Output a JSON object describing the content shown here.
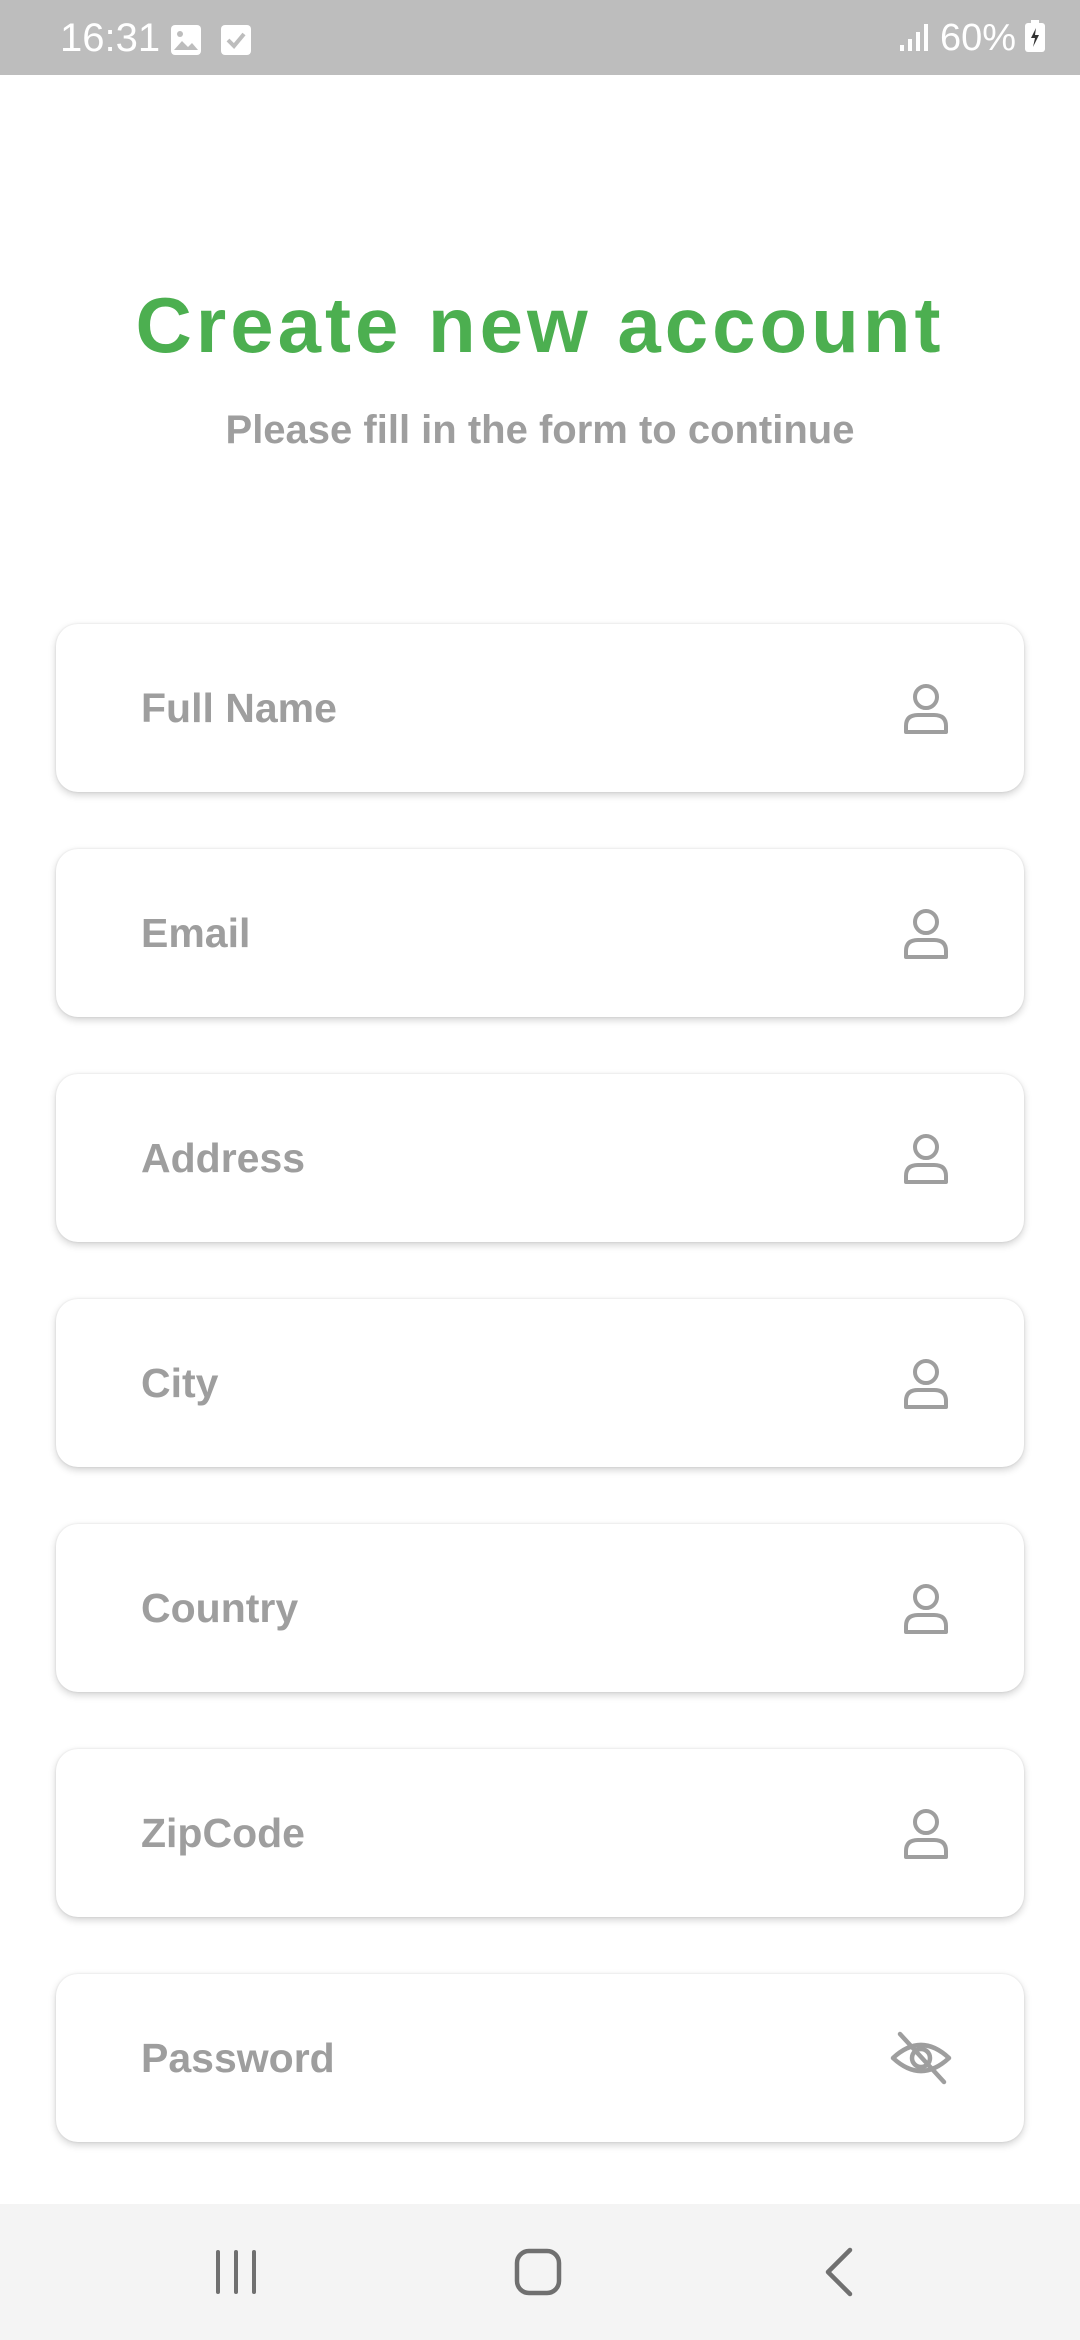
{
  "status_bar": {
    "time": "16:31",
    "battery": "60%",
    "icons": [
      "image-icon",
      "check-box-icon",
      "signal-icon",
      "battery-icon"
    ]
  },
  "header": {
    "title": "Create new account",
    "subtitle": "Please fill in the form to continue"
  },
  "form": {
    "fields": [
      {
        "placeholder": "Full Name",
        "icon": "person-icon"
      },
      {
        "placeholder": "Email",
        "icon": "person-icon"
      },
      {
        "placeholder": "Address",
        "icon": "person-icon"
      },
      {
        "placeholder": "City",
        "icon": "person-icon"
      },
      {
        "placeholder": "Country",
        "icon": "person-icon"
      },
      {
        "placeholder": "ZipCode",
        "icon": "person-icon"
      },
      {
        "placeholder": "Password",
        "icon": "eye-off-icon"
      }
    ]
  },
  "nav_bar": {
    "icons": [
      "recent-apps-icon",
      "home-icon",
      "back-icon"
    ]
  },
  "colors": {
    "accent": "#4caf50",
    "muted_text": "#9e9e9e",
    "status_bar": "#bdbdbd",
    "nav_bar": "#f4f4f4"
  }
}
